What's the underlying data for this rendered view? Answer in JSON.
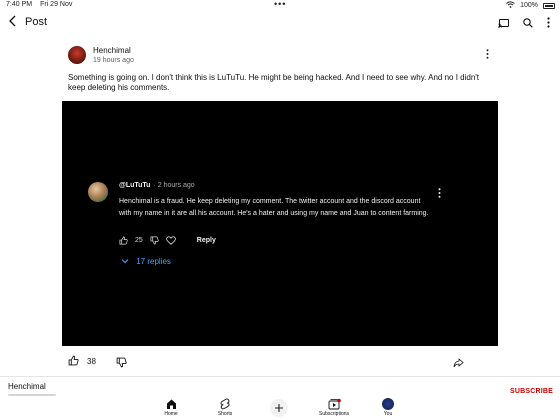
{
  "status_bar": {
    "time": "7:40 PM",
    "date": "Fri 29 Nov",
    "dots": "•••",
    "battery": "100%"
  },
  "header": {
    "back_icon": "chevron-left-icon",
    "title": "Post",
    "icons": [
      "cast-icon",
      "search-icon",
      "more-vert-icon"
    ]
  },
  "post": {
    "author": "Henchimal",
    "time": "19 hours ago",
    "text": "Something is going on. I don't think this is LuTuTu. He might be being hacked. And I need to see why. And no I didn't keep deleting his comments.",
    "likes": "38"
  },
  "image_comment": {
    "handle": "@LuTuTu",
    "time": "· 2 hours ago",
    "text": "Henchimal is a fraud. He keep deleting my comment. The twitter account and the discord account with my name in it are all his account. He's a hater and using my name and Juan to content farming.",
    "likes": "25",
    "reply_label": "Reply",
    "replies_label": "17 replies"
  },
  "channel_bar": {
    "name": "Henchimal",
    "subscribe_label": "SUBSCRIBE"
  },
  "nav": {
    "home": "Home",
    "shorts": "Shorts",
    "subscriptions": "Subscriptions",
    "you": "You"
  },
  "colors": {
    "accent_blue": "#3ea6ff",
    "subscribe_red": "#cc0000",
    "image_bg": "#000000"
  }
}
